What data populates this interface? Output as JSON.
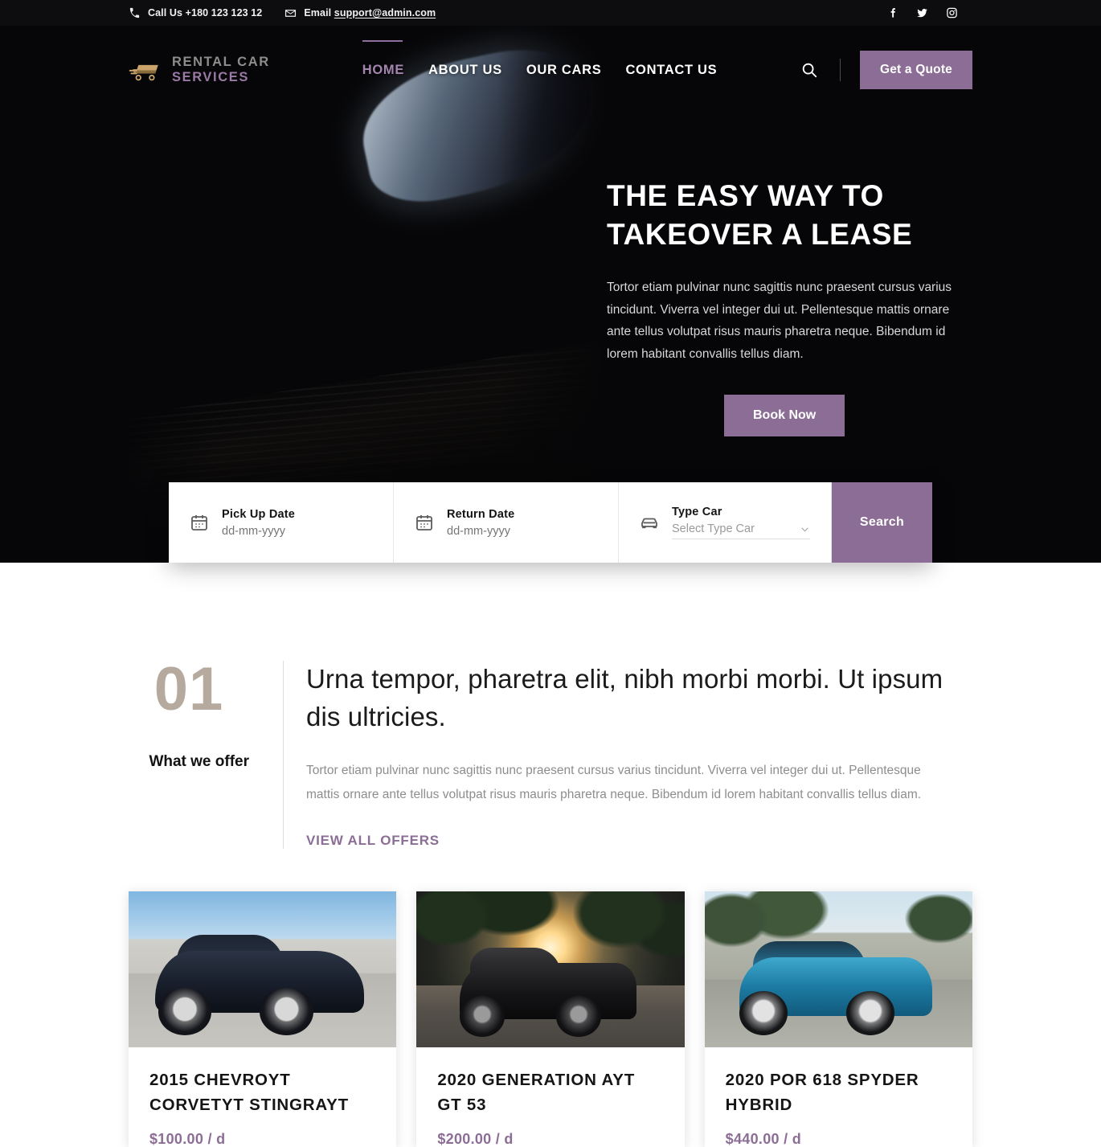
{
  "topbar": {
    "phone_label": "Call Us",
    "phone": "+180 123 123 12",
    "email_label": "Email",
    "email": "support@admin.com",
    "socials": [
      {
        "name": "facebook-icon",
        "label": "Facebook"
      },
      {
        "name": "twitter-icon",
        "label": "Twitter"
      },
      {
        "name": "instagram-icon",
        "label": "Instagram"
      }
    ]
  },
  "brand": {
    "line1": "RENTAL CAR",
    "line2": "SERVICES",
    "icon": "car-logo-icon"
  },
  "nav": {
    "items": [
      {
        "label": "HOME",
        "active": true
      },
      {
        "label": "ABOUT US",
        "active": false
      },
      {
        "label": "OUR CARS",
        "active": false
      },
      {
        "label": "CONTACT US",
        "active": false
      }
    ],
    "search_icon": "search-icon",
    "quote_button": "Get a Quote"
  },
  "hero": {
    "title": "THE EASY WAY TO TAKEOVER A LEASE",
    "description": "Tortor etiam pulvinar nunc sagittis nunc praesent cursus varius tincidunt. Viverra vel integer dui ut. Pellentesque mattis ornare ante tellus volutpat risus mauris pharetra neque. Bibendum id lorem habitant convallis tellus diam.",
    "cta": "Book Now",
    "image_alt": "golden car front headlight close-up"
  },
  "bookbar": {
    "pickup": {
      "label": "Pick Up Date",
      "placeholder": "dd-mm-yyyy",
      "value": "",
      "icon": "calendar-icon"
    },
    "return": {
      "label": "Return Date",
      "placeholder": "dd-mm-yyyy",
      "value": "",
      "icon": "calendar-icon"
    },
    "type": {
      "label": "Type Car",
      "selected": "Select Type Car",
      "options": [
        "Select Type Car"
      ],
      "icon": "car-icon",
      "chevron": "chevron-down-icon"
    },
    "search_button": "Search"
  },
  "offers": {
    "number": "01",
    "kicker": "What we offer",
    "title": "Urna tempor, pharetra elit, nibh morbi morbi. Ut ipsum dis ultricies.",
    "description": "Tortor etiam pulvinar nunc sagittis nunc praesent cursus varius tincidunt. Viverra vel integer dui ut. Pellentesque mattis ornare ante tellus volutpat risus mauris pharetra neque. Bibendum id lorem habitant convallis tellus diam.",
    "link": "VIEW ALL OFFERS"
  },
  "cars": [
    {
      "title": "2015 CHEVROYT CORVETYT STINGRAYT",
      "price": "$100.00 / d",
      "image_alt": "dark blue sedan parked on rooftop"
    },
    {
      "title": "2020 GENERATION AYT GT 53",
      "price": "$200.00 / d",
      "image_alt": "black muscle car at sunset"
    },
    {
      "title": "2020 POR 618 SPYDER HYBRID",
      "price": "$440.00 / d",
      "image_alt": "blue hatchback parked on street"
    }
  ],
  "colors": {
    "accent": "#8c6d96",
    "accent_light": "#a584b0",
    "dark": "#060608",
    "number_tan": "#b6a99d"
  }
}
